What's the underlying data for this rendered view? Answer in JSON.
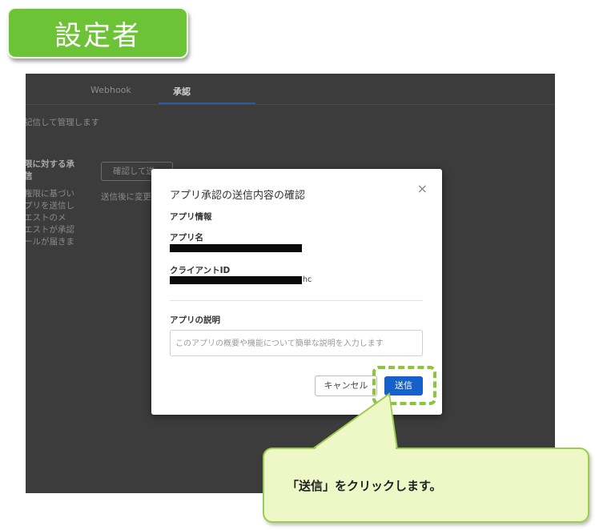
{
  "badge": {
    "label": "設定者"
  },
  "tabs": [
    {
      "label": "Webhook",
      "active": false
    },
    {
      "label": "承認",
      "active": true
    }
  ],
  "background": {
    "desc_line": "記信して管理します",
    "section_heading": [
      "限に対する承",
      "信"
    ],
    "section_body": [
      "権限に基づい",
      "プリを送信し",
      "エストのメ",
      "エストが承認",
      "ールが届きま"
    ],
    "confirm_button": "確認して送",
    "after_send_text": "送信後に変更"
  },
  "modal": {
    "title": "アプリ承認の送信内容の確認",
    "close_symbol": "×",
    "section_app_info": "アプリ情報",
    "app_name_label": "アプリ名",
    "client_id_label": "クライアントID",
    "client_id_suffix": "hc",
    "description_label": "アプリの説明",
    "description_placeholder": "このアプリの概要や機能について簡単な説明を入力します",
    "cancel_label": "キャンセル",
    "send_label": "送信"
  },
  "callout": {
    "text": "「送信」をクリックします。"
  },
  "colors": {
    "accent_green": "#6cc336",
    "send_blue": "#1560c9",
    "callout_fill": "#eef7c6",
    "highlight_green": "#8ac63a"
  }
}
